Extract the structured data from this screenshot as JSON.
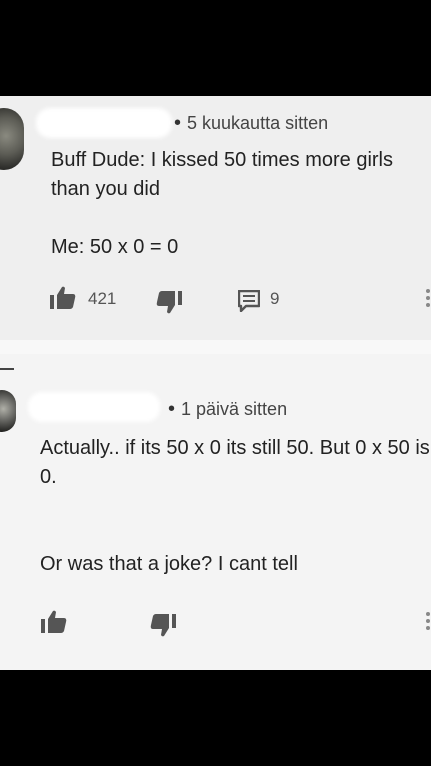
{
  "comments": [
    {
      "timestamp": "5 kuukautta sitten",
      "text": "Buff Dude: I kissed 50 times more girls than you did\n\nMe: 50 x 0 = 0",
      "like_count": "421",
      "reply_count": "9"
    },
    {
      "timestamp": "1 päivä sitten",
      "text": "Actually.. if its 50 x 0 its still 50. But 0 x 50 is 0.\n\n\nOr was that a joke? I cant tell"
    }
  ],
  "icons": {
    "like": "thumbs-up-icon",
    "dislike": "thumbs-down-icon",
    "reply": "comment-icon",
    "more": "more-vertical-icon"
  },
  "colors": {
    "background_top": "#000000",
    "comment_bg": "#efefef",
    "text": "#222222",
    "icon": "#555555"
  }
}
